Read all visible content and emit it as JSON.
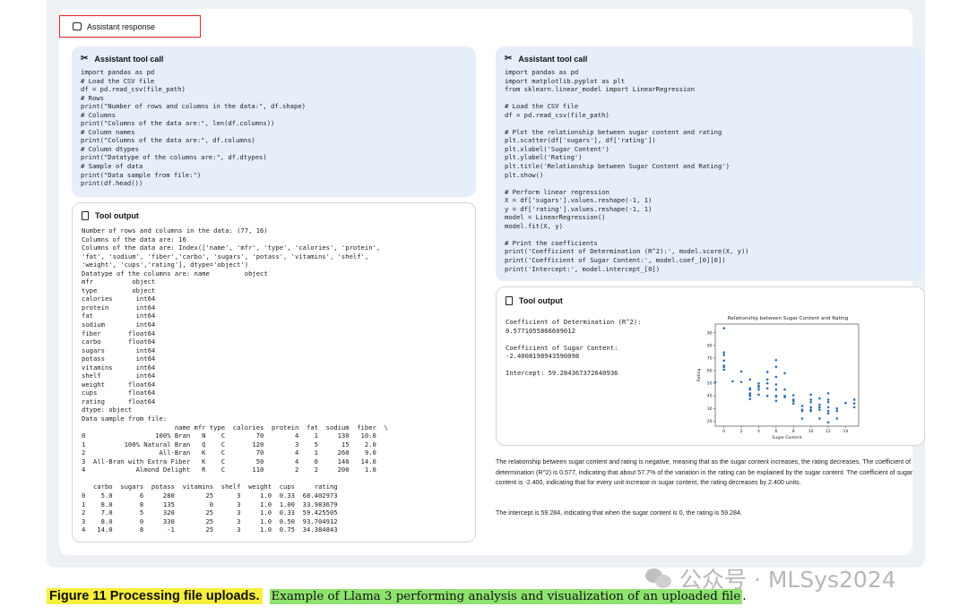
{
  "response_header": "Assistant response",
  "left": {
    "tool_call": {
      "title": "Assistant tool call",
      "code": "import pandas as pd\n# Load the CSV file\ndf = pd.read_csv(file_path)\n# Rows\nprint(\"Number of rows and columns in the data:\", df.shape)\n# Columns\nprint(\"Columns of the data are:\", len(df.columns))\n# Column names\nprint(\"Columns of the data are:\", df.columns)\n# Column dtypes\nprint(\"Datatype of the columns are:\", df.dtypes)\n# Sample of data\nprint(\"Data sample from file:\")\nprint(df.head())"
    },
    "tool_output": {
      "title": "Tool output",
      "text": "Number of rows and columns in the data: (77, 16)\nColumns of the data are: 16\nColumns of the data are: Index(['name', 'mfr', 'type', 'calories', 'protein',\n'fat', 'sodium', 'fiber','carbo', 'sugars', 'potass', 'vitamins', 'shelf',\n'weight', 'cups','rating'], dtype='object')\nDatatype of the columns are: name         object\nmfr          object\ntype         object\ncalories      int64\nprotein       int64\nfat           int64\nsodium        int64\nfiber       float64\ncarbo       float64\nsugars        int64\npotass        int64\nvitamins      int64\nshelf         int64\nweight      float64\ncups        float64\nrating      float64\ndtype: object\nData sample from file:\n                        name mfr type  calories  protein  fat  sodium  fiber  \\\n0                  100% Bran   N    C        70        4    1     130   10.0\n1          100% Natural Bran   Q    C       120        3    5      15    2.0\n2                   All-Bran   K    C        70        4    1     260    9.0\n3  All-Bran with Extra Fiber   K    C        50        4    0     140   14.0\n4             Almond Delight   R    C       110        2    2     200    1.0\n\n   carbo  sugars  potass  vitamins  shelf  weight  cups     rating\n0    5.0       6     280        25      3     1.0  0.33  68.402973\n1    8.0       8     135         0      3     1.0  1.00  33.983679\n2    7.0       5     320        25      3     1.0  0.33  59.425505\n3    8.0       0     330        25      3     1.0  0.50  93.704912\n4   14.0       8      -1        25      3     1.0  0.75  34.384843"
    }
  },
  "right": {
    "tool_call": {
      "title": "Assistant tool call",
      "code": "import pandas as pd\nimport matplotlib.pyplot as plt\nfrom sklearn.linear_model import LinearRegression\n\n# Load the CSV file\ndf = pd.read_csv(file_path)\n\n# Plot the relationship between sugar content and rating\nplt.scatter(df['sugars'], df['rating'])\nplt.xlabel('Sugar Content')\nplt.ylabel('Rating')\nplt.title('Relationship between Sugar Content and Rating')\nplt.show()\n\n# Perform linear regression\nX = df['sugars'].values.reshape(-1, 1)\ny = df['rating'].values.reshape(-1, 1)\nmodel = LinearRegression()\nmodel.fit(X, y)\n\n# Print the coefficients\nprint('Coefficient of Determination (R^2):', model.score(X, y))\nprint('Coefficient of Sugar Content:', model.coef_[0][0])\nprint('Intercept:', model.intercept_[0])"
    },
    "tool_output": {
      "title": "Tool output",
      "text": "Coefficient of Determination (R^2):\n0.5771055866609012\n\nCoefficient of Sugar Content:\n-2.4008198943590098\n\nIntercept: 59.284367372640936"
    },
    "paragraph1": "The relationship between sugar content and rating is negative, meaning that as the sugar content increases, the rating decreases. The coefficient of determination (R^2) is 0.577, indicating that about 57.7% of the variation in the rating can be explained by the sugar content. The coefficient of sugar content is -2.400, indicating that for every unit increase in sugar content, the rating decreases by 2.400 units.",
    "paragraph2": "The intercept is 59.284, indicating that when the sugar content is 0, the rating is 59.284."
  },
  "chart_data": {
    "type": "scatter",
    "title": "Relationship between Sugar Content and Rating",
    "xlabel": "Sugar Content",
    "ylabel": "Rating",
    "xlim": [
      -1,
      15.5
    ],
    "ylim": [
      16,
      97
    ],
    "xticks": [
      0,
      2,
      4,
      6,
      8,
      10,
      12,
      14
    ],
    "yticks": [
      20,
      30,
      40,
      50,
      60,
      70,
      80,
      90
    ],
    "points": [
      [
        0,
        93.7
      ],
      [
        0,
        74.5
      ],
      [
        0,
        72.5
      ],
      [
        0,
        68
      ],
      [
        0,
        64
      ],
      [
        0,
        63
      ],
      [
        0,
        60.8
      ],
      [
        -1,
        51
      ],
      [
        1,
        51.6
      ],
      [
        2,
        59.4
      ],
      [
        2,
        51
      ],
      [
        3,
        53
      ],
      [
        3,
        46
      ],
      [
        3,
        45
      ],
      [
        3,
        40
      ],
      [
        3,
        41
      ],
      [
        3,
        42
      ],
      [
        3,
        37.5
      ],
      [
        4,
        50
      ],
      [
        4,
        47
      ],
      [
        4,
        45
      ],
      [
        4,
        41
      ],
      [
        4,
        48
      ],
      [
        5,
        59
      ],
      [
        5,
        53
      ],
      [
        5,
        50
      ],
      [
        5,
        46
      ],
      [
        5,
        40
      ],
      [
        6,
        68.4
      ],
      [
        6,
        63
      ],
      [
        6,
        55
      ],
      [
        6,
        49
      ],
      [
        6,
        45
      ],
      [
        6,
        40
      ],
      [
        6,
        39.5
      ],
      [
        6,
        36
      ],
      [
        7,
        58
      ],
      [
        7,
        45
      ],
      [
        7,
        40
      ],
      [
        7,
        39
      ],
      [
        8,
        40.5
      ],
      [
        8,
        37
      ],
      [
        8,
        36
      ],
      [
        8,
        34
      ],
      [
        8,
        33.9
      ],
      [
        9,
        32
      ],
      [
        9,
        29
      ],
      [
        9,
        28
      ],
      [
        9,
        22
      ],
      [
        10,
        41
      ],
      [
        10,
        37
      ],
      [
        10,
        35
      ],
      [
        10,
        31
      ],
      [
        10,
        29
      ],
      [
        10,
        28
      ],
      [
        11,
        38
      ],
      [
        11,
        33
      ],
      [
        11,
        31
      ],
      [
        11,
        29
      ],
      [
        11,
        22
      ],
      [
        12,
        42
      ],
      [
        12,
        37
      ],
      [
        12,
        35
      ],
      [
        12,
        31
      ],
      [
        12,
        28
      ],
      [
        12,
        26
      ],
      [
        12,
        19
      ],
      [
        13,
        30
      ],
      [
        13,
        28
      ],
      [
        13,
        22
      ],
      [
        14,
        34.4
      ],
      [
        15,
        37
      ],
      [
        15,
        34
      ],
      [
        15,
        31
      ]
    ]
  },
  "caption": {
    "label": "Figure 11  Processing file uploads.",
    "text": "Example of Llama 3 performing analysis and visualization of an uploaded file",
    "period": "."
  },
  "watermark": "公众号 · MLSys2024",
  "icons": {
    "response": "chat-bubble-icon",
    "tool_call": "tools-icon",
    "tool_output": "document-icon",
    "watermark": "wechat-logo-icon"
  }
}
